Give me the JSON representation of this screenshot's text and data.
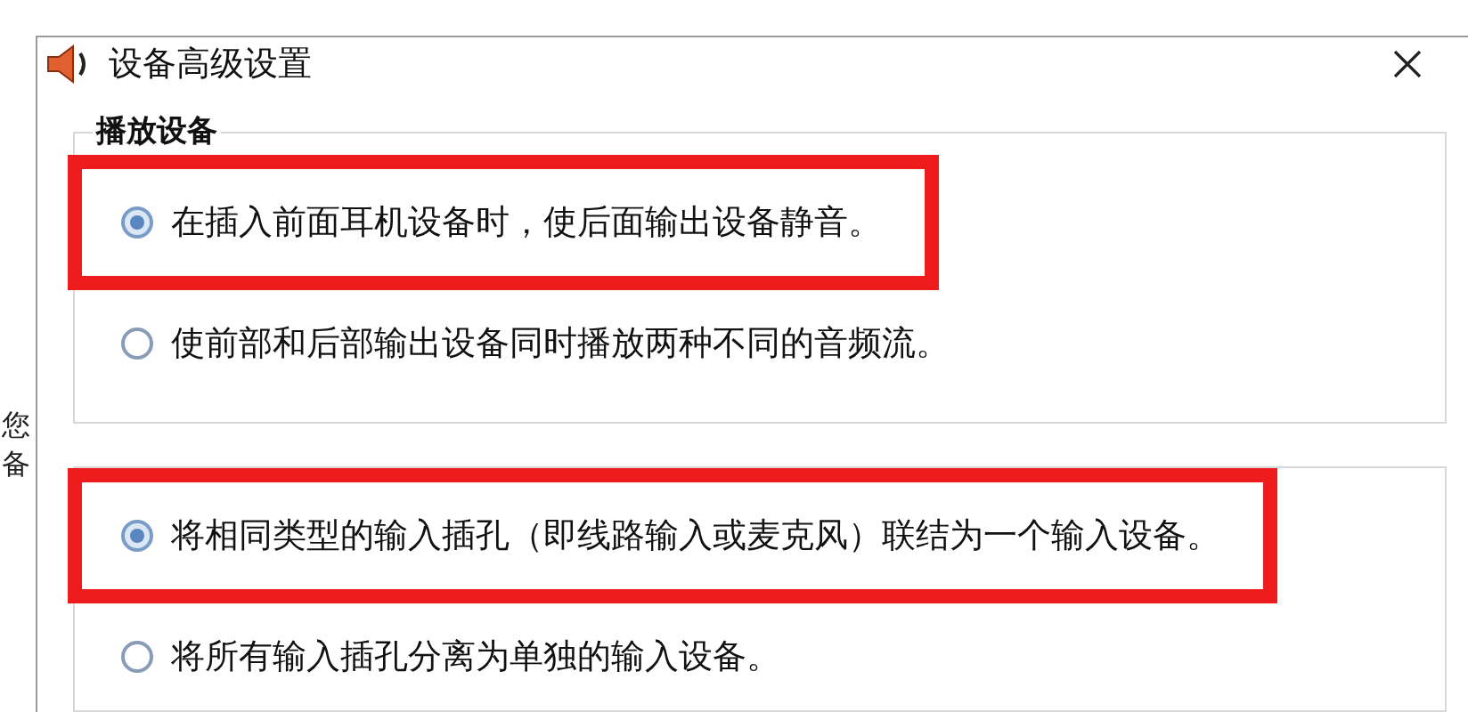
{
  "window": {
    "title": "设备高级设置"
  },
  "background_text": [
    "您",
    "备"
  ],
  "groups": [
    {
      "label": "播放设备",
      "options": [
        {
          "label": "在插入前面耳机设备时，使后面输出设备静音。",
          "selected": true,
          "highlighted": true
        },
        {
          "label": "使前部和后部输出设备同时播放两种不同的音频流。",
          "selected": false,
          "highlighted": false
        }
      ]
    },
    {
      "options": [
        {
          "label": "将相同类型的输入插孔（即线路输入或麦克风）联结为一个输入设备。",
          "selected": true,
          "highlighted": true
        },
        {
          "label": "将所有输入插孔分离为单独的输入设备。",
          "selected": false,
          "highlighted": false
        }
      ]
    }
  ]
}
